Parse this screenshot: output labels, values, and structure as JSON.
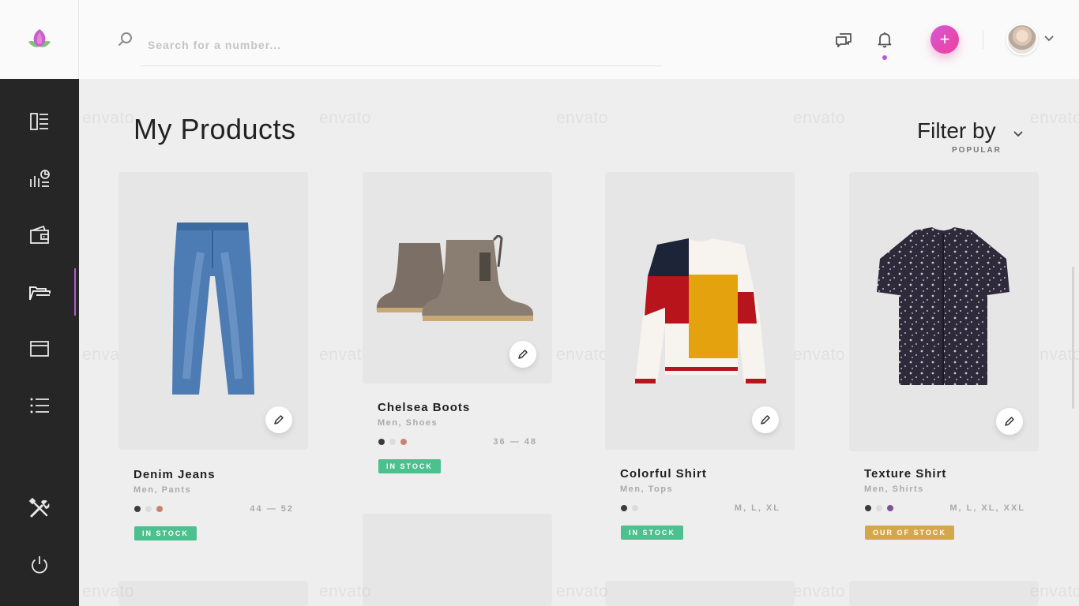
{
  "search": {
    "placeholder": "Search for a number..."
  },
  "header": {
    "add_label": "+"
  },
  "page": {
    "title": "My Products",
    "filter_label": "Filter by",
    "filter_value": "POPULAR"
  },
  "watermark": "envato",
  "colors": {
    "accent": "#b35bd8",
    "in_stock": "#4cc08e",
    "out_of_stock": "#d5a74d",
    "sidebar": "#262626"
  },
  "sidebar": {
    "items": [
      {
        "icon": "dashboard-icon"
      },
      {
        "icon": "analytics-icon"
      },
      {
        "icon": "wallet-icon"
      },
      {
        "icon": "products-icon",
        "active": true
      },
      {
        "icon": "browser-window-icon"
      },
      {
        "icon": "list-icon"
      },
      {
        "icon": "tools-icon"
      },
      {
        "icon": "power-icon"
      }
    ]
  },
  "products": [
    {
      "name": "Denim Jeans",
      "category": "Men, Pants",
      "sizes": "44 — 52",
      "status": "IN STOCK",
      "colors": [
        "#3b3b3b",
        "#dcdcdc",
        "#c68470"
      ]
    },
    {
      "name": "Chelsea Boots",
      "category": "Men, Shoes",
      "sizes": "36 — 48",
      "status": "IN STOCK",
      "colors": [
        "#3b3b3b",
        "#dcdcdc",
        "#c68470"
      ]
    },
    {
      "name": "Colorful Shirt",
      "category": "Men, Tops",
      "sizes": "M, L, XL",
      "status": "IN STOCK",
      "colors": [
        "#3b3b3b",
        "#dcdcdc"
      ]
    },
    {
      "name": "Texture Shirt",
      "category": "Men, Shirts",
      "sizes": "M, L, XL, XXL",
      "status": "OUR OF STOCK",
      "colors": [
        "#3b3b3b",
        "#dcdcdc",
        "#7d5491"
      ]
    }
  ]
}
